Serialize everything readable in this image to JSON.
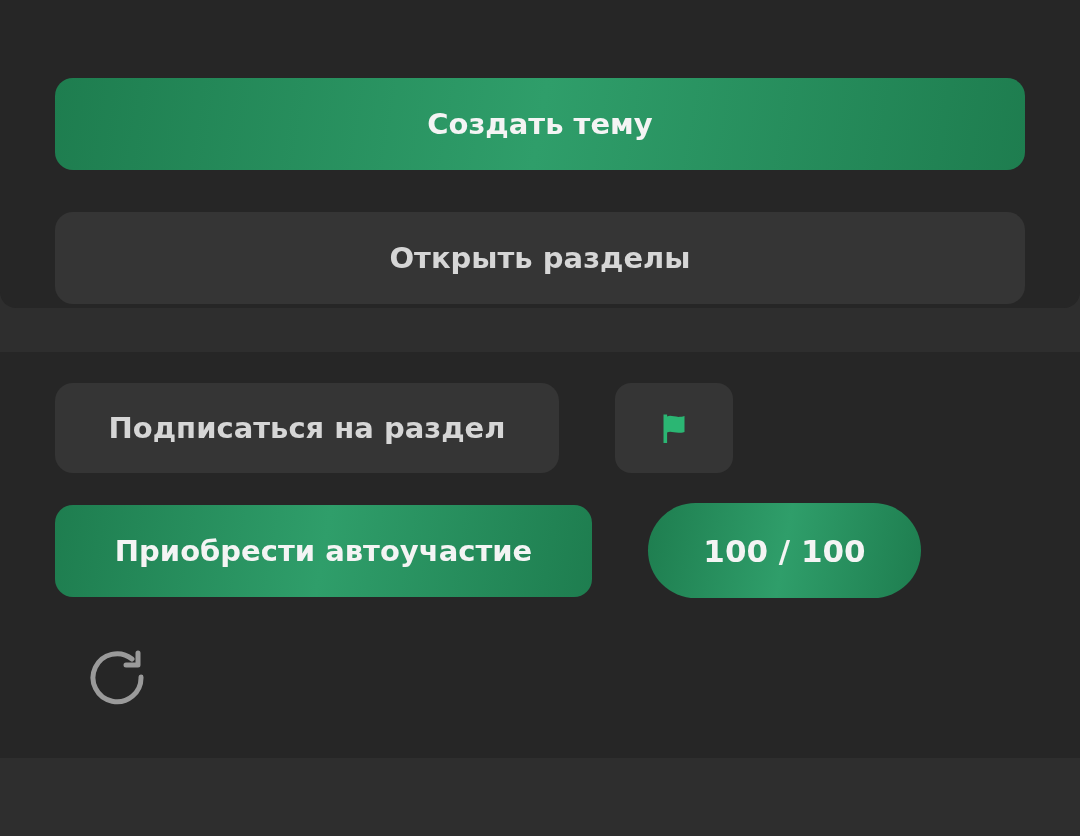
{
  "top_actions": [
    {
      "label": "Создать тему",
      "kind": "primary"
    },
    {
      "label": "Открыть разделы",
      "kind": "secondary"
    }
  ],
  "subscribe": {
    "label": "Подписаться на раздел"
  },
  "flag_button": {
    "kind": "flag"
  },
  "auto": {
    "label": "Приобрести автоучастие",
    "counter": "100 / 100"
  },
  "refresh": {
    "kind": "refresh"
  }
}
